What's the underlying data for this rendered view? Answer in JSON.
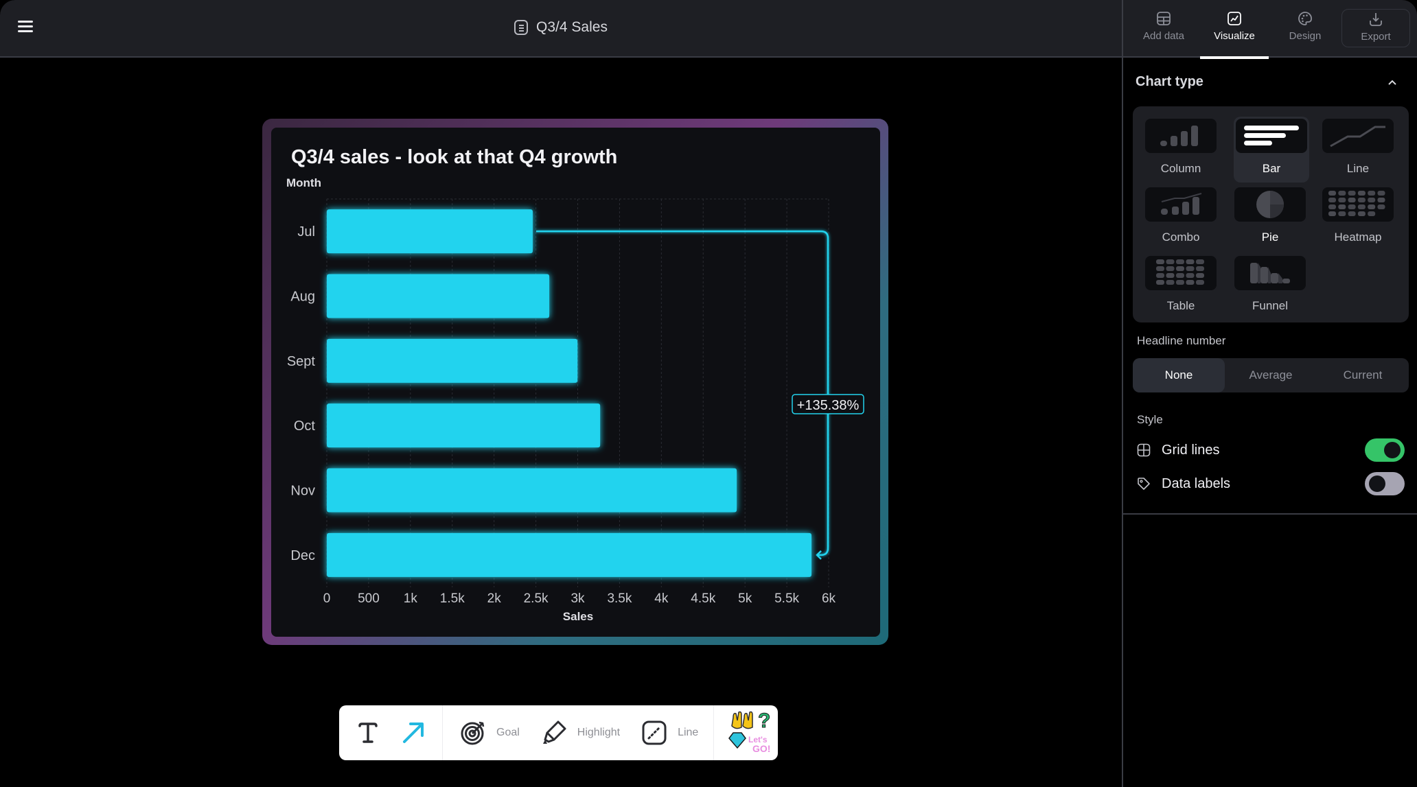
{
  "header": {
    "menu_icon": "hamburger-menu-icon",
    "document_icon": "document-icon",
    "document_title": "Q3/4 Sales"
  },
  "panel": {
    "tabs": [
      {
        "label": "Add data",
        "icon": "table-icon",
        "active": false
      },
      {
        "label": "Visualize",
        "icon": "chart-line-icon",
        "active": true
      },
      {
        "label": "Design",
        "icon": "palette-icon",
        "active": false
      },
      {
        "label": "Export",
        "icon": "download-icon",
        "active": false
      }
    ],
    "chart_type": {
      "title": "Chart type",
      "options": [
        {
          "label": "Column",
          "selected": false
        },
        {
          "label": "Bar",
          "selected": true
        },
        {
          "label": "Line",
          "selected": false
        },
        {
          "label": "Combo",
          "selected": false
        },
        {
          "label": "Pie",
          "selected": false
        },
        {
          "label": "Heatmap",
          "selected": false
        },
        {
          "label": "Table",
          "selected": false
        },
        {
          "label": "Funnel",
          "selected": false
        }
      ]
    },
    "headline_number": {
      "label": "Headline number",
      "options": [
        "None",
        "Average",
        "Current"
      ],
      "selected": "None"
    },
    "style": {
      "label": "Style",
      "grid_lines": {
        "label": "Grid lines",
        "on": true
      },
      "data_labels": {
        "label": "Data labels",
        "on": false
      }
    }
  },
  "colors": {
    "bar": "#22d3ee",
    "toggle_on": "#35c468",
    "toggle_off": "#a6a4b2",
    "card_bg": "#0e0f13"
  },
  "chart_data": {
    "type": "bar",
    "orientation": "horizontal",
    "title": "Q3/4 sales - look at that Q4 growth",
    "ylabel": "Month",
    "xlabel": "Sales",
    "categories": [
      "Jul",
      "Aug",
      "Sept",
      "Oct",
      "Nov",
      "Dec"
    ],
    "values": [
      2462,
      2660,
      2997,
      3268,
      4901,
      5795
    ],
    "xlim": [
      0,
      6000
    ],
    "x_ticks": [
      0,
      500,
      1000,
      1500,
      2000,
      2500,
      3000,
      3500,
      4000,
      4500,
      5000,
      5500,
      6000
    ],
    "x_tick_labels": [
      "0",
      "500",
      "1k",
      "1.5k",
      "2k",
      "2.5k",
      "3k",
      "3.5k",
      "4k",
      "4.5k",
      "5k",
      "5.5k",
      "6k"
    ],
    "grid": true,
    "data_labels": false,
    "annotation": {
      "type": "growth-arrow",
      "from": "Jul",
      "to": "Dec",
      "label": "+135.38%"
    }
  },
  "toolbar": {
    "items": [
      {
        "name": "text",
        "icon": "text-icon",
        "label": ""
      },
      {
        "name": "arrow",
        "icon": "arrow-icon",
        "label": ""
      },
      {
        "name": "goal",
        "icon": "target-icon",
        "label": "Goal"
      },
      {
        "name": "highlight",
        "icon": "highlighter-icon",
        "label": "Highlight"
      },
      {
        "name": "line",
        "icon": "line-icon",
        "label": "Line"
      },
      {
        "name": "stickers",
        "icon": "sticker-icon",
        "label": ""
      }
    ],
    "sticker_text": "Let's GO!"
  }
}
